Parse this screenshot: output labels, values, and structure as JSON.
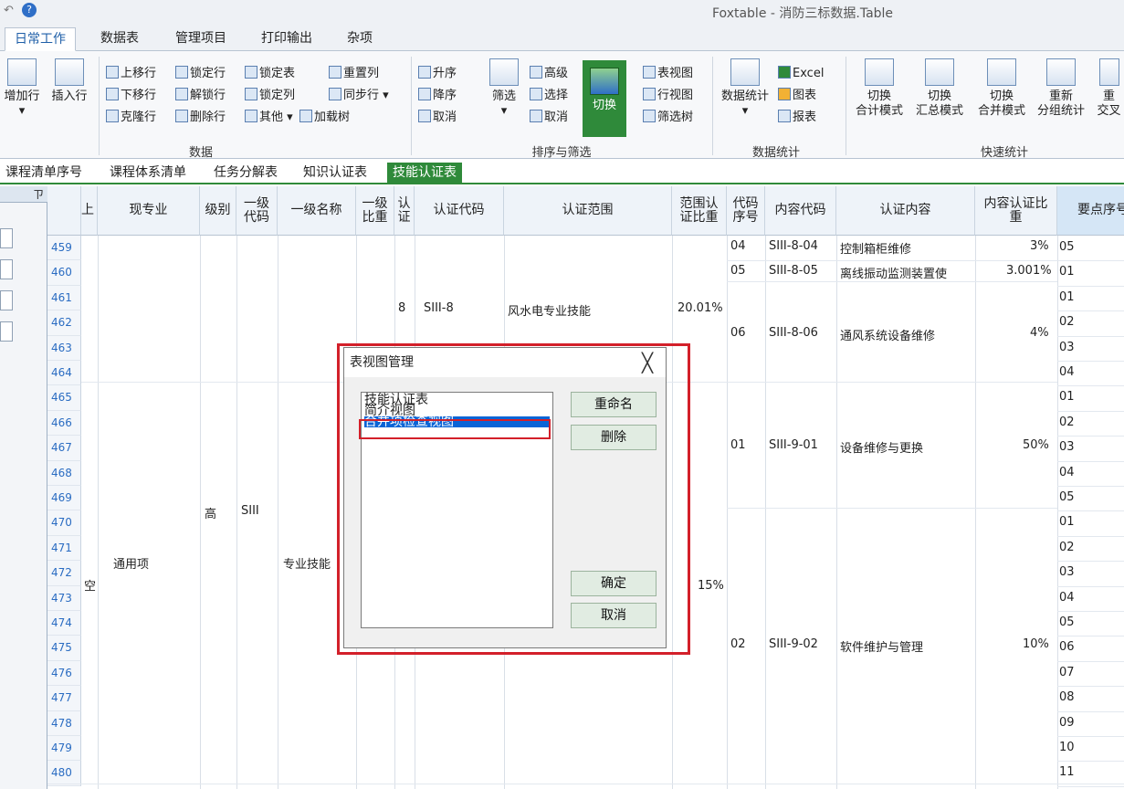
{
  "app": {
    "title": "Foxtable - 消防三标数据.Table"
  },
  "ribbon_tabs": [
    "日常工作",
    "数据表",
    "管理项目",
    "打印输出",
    "杂项"
  ],
  "ribbon": {
    "row_buttons": {
      "add_row": "增加行",
      "insert_row": "插入行"
    },
    "data_group": {
      "label": "数据",
      "move_up": "上移行",
      "lock_row": "锁定行",
      "lock_table": "锁定表",
      "reset_cols": "重置列",
      "move_down": "下移行",
      "unlock_row": "解锁行",
      "lock_col": "锁定列",
      "sync_row": "同步行",
      "clone_row": "克隆行",
      "delete_row": "删除行",
      "other": "其他",
      "load_tree": "加载树"
    },
    "sort_group": {
      "label": "排序与筛选",
      "asc": "升序",
      "desc": "降序",
      "cancel_sort": "取消",
      "filter": "筛选",
      "advanced": "高级",
      "select": "选择",
      "cancel_filter": "取消",
      "switch": "切换",
      "table_view": "表视图",
      "row_view": "行视图",
      "filter_tree": "筛选树"
    },
    "stats_group": {
      "label": "数据统计",
      "data_stats": "数据统计",
      "excel": "Excel",
      "chart": "图表",
      "report": "报表"
    },
    "quick_group": {
      "label": "快速统计",
      "b1": [
        "切换",
        "合计模式"
      ],
      "b2": [
        "切换",
        "汇总模式"
      ],
      "b3": [
        "切换",
        "合并模式"
      ],
      "b4": [
        "重新",
        "分组统计"
      ],
      "b5": [
        "重",
        "交叉"
      ]
    }
  },
  "doc_tabs": [
    "课程清单序号",
    "课程体系清单",
    "任务分解表",
    "知识认证表",
    "技能认证表"
  ],
  "left_panel": {
    "pin": "ㄗ"
  },
  "columns": [
    "上",
    "现专业",
    "级别",
    "一级代码",
    "一级名称",
    "一级比重",
    "认证",
    "认证代码",
    "认证范围",
    "范围认证比重",
    "代码序号",
    "内容代码",
    "认证内容",
    "内容认证比重",
    "要点序号"
  ],
  "rows": [
    "459",
    "460",
    "461",
    "462",
    "463",
    "464",
    "465",
    "466",
    "467",
    "468",
    "469",
    "470",
    "471",
    "472",
    "473",
    "474",
    "475",
    "476",
    "477",
    "478",
    "479",
    "480"
  ],
  "merged": {
    "major": "通用项",
    "level": "高",
    "code1": "SIII",
    "name1": "专业技能",
    "auth": "8",
    "auth_code": "SIII-8",
    "auth_range": "风水电专业技能",
    "range_ratio1": "20.01%",
    "range_ratio2": "15%",
    "col0_char": "空"
  },
  "content_rows": [
    {
      "seq": "04",
      "code": "SIII-8-04",
      "content": "控制箱柜维修",
      "ratio": "3%"
    },
    {
      "seq": "05",
      "code": "SIII-8-05",
      "content": "离线振动监测装置使",
      "ratio": "3.001%"
    },
    {
      "seq": "06",
      "code": "SIII-8-06",
      "content": "通风系统设备维修",
      "ratio": "4%"
    },
    {
      "seq": "01",
      "code": "SIII-9-01",
      "content": "设备维修与更换",
      "ratio": "50%"
    },
    {
      "seq": "02",
      "code": "SIII-9-02",
      "content": "软件维护与管理",
      "ratio": "10%"
    }
  ],
  "points": [
    "05",
    "01",
    "01",
    "02",
    "03",
    "04",
    "01",
    "02",
    "03",
    "04",
    "05",
    "01",
    "02",
    "03",
    "04",
    "05",
    "06",
    "07",
    "08",
    "09",
    "10",
    "11"
  ],
  "dialog": {
    "title": "表视图管理",
    "close": "╳",
    "items": [
      "技能认证表",
      "简介视图",
      "合并项检查视图"
    ],
    "selected": 2,
    "rename": "重命名",
    "delete": "删除",
    "ok": "确定",
    "cancel": "取消"
  },
  "colors": {
    "accent_green": "#2f8a3a",
    "highlight_red": "#d3202a",
    "selection_blue": "#0a64d6"
  }
}
